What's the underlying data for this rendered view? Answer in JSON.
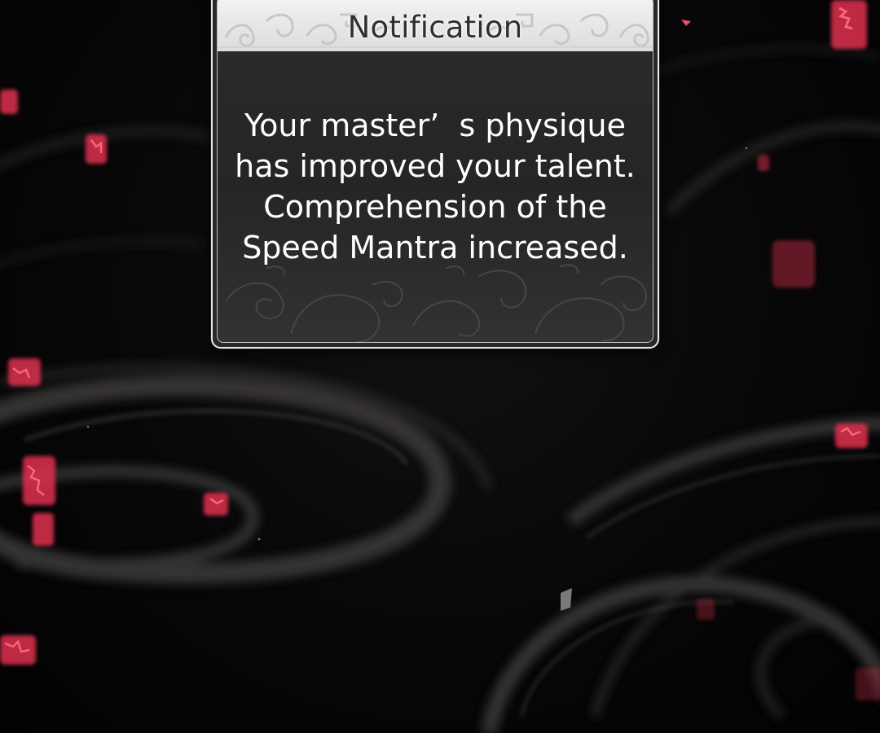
{
  "notification": {
    "title": "Notification",
    "message_lines": [
      "Your master’  s physique",
      "has improved your talent.",
      "Comprehension of the",
      "Speed Mantra increased."
    ]
  },
  "colors": {
    "background": "#050405",
    "panel": "#2a292a",
    "header": "#e6e6e6",
    "border": "#e9e9e9",
    "rune_glow": "#e0334f"
  },
  "icons": [
    "red-rune-glyph",
    "swirl-smoke"
  ]
}
